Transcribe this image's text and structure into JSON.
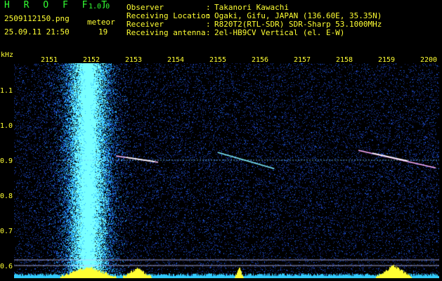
{
  "header": {
    "app_title": "H R O F F T",
    "version": "1.0.0",
    "filename": "2509112150.png",
    "meteor_label": "meteor",
    "datetime": "25.09.11 21:50",
    "meteor_count": "19",
    "fields": [
      {
        "label": "Observer",
        "sep": ":",
        "value": "Takanori Kawachi"
      },
      {
        "label": "Receiving Location",
        "sep": ":",
        "value": "Ogaki, Gifu, JAPAN (136.60E, 35.35N)"
      },
      {
        "label": "Receiver",
        "sep": ":",
        "value": "R820T2(RTL-SDR) SDR-Sharp 53.1000MHz"
      },
      {
        "label": "Receiving antenna",
        "sep": ":",
        "value": "2el-HB9CV Vertical (el. E-W)"
      }
    ]
  },
  "axes": {
    "y_unit": "kHz",
    "y_ticks": [
      "1.1",
      "1.0",
      "0.9",
      "0.8",
      "0.7",
      "0.6"
    ],
    "x_ticks": [
      "2151",
      "2152",
      "2153",
      "2154",
      "2155",
      "2156",
      "2157",
      "2158",
      "2159",
      "2200"
    ]
  },
  "colors": {
    "background": "#000000",
    "noise": "#1a2a8c",
    "signal": "#4ff0ff",
    "text": "#ffff33",
    "title": "#33ff33"
  }
}
